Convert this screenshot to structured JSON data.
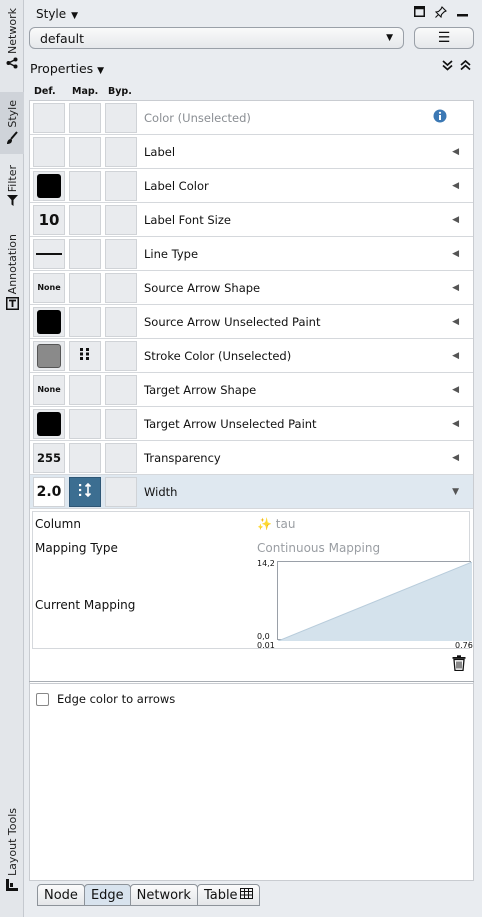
{
  "sidebar": {
    "tabs": [
      {
        "label": "Network",
        "icon": "share-icon"
      },
      {
        "label": "Style",
        "icon": "brush-icon",
        "active": true
      },
      {
        "label": "Filter",
        "icon": "funnel-icon"
      },
      {
        "label": "Annotation",
        "icon": "annotation-icon"
      },
      {
        "label": "Layout Tools",
        "icon": "layout-icon"
      }
    ]
  },
  "header": {
    "title": "Style",
    "style_select": "default",
    "properties_label": "Properties"
  },
  "columns": {
    "def": "Def.",
    "map": "Map.",
    "byp": "Byp."
  },
  "properties": [
    {
      "label": "Color (Unselected)",
      "def": "",
      "def_kind": "empty",
      "map_kind": "empty",
      "dim": true,
      "trailing": "info-icon"
    },
    {
      "label": "Label",
      "def": "",
      "def_kind": "empty",
      "map_kind": "empty"
    },
    {
      "label": "Label Color",
      "def": "",
      "def_kind": "black",
      "map_kind": "empty"
    },
    {
      "label": "Label Font Size",
      "def": "10",
      "def_kind": "big",
      "map_kind": "empty"
    },
    {
      "label": "Line Type",
      "def": "",
      "def_kind": "line",
      "map_kind": "empty"
    },
    {
      "label": "Source Arrow Shape",
      "def": "None",
      "def_kind": "small",
      "map_kind": "empty"
    },
    {
      "label": "Source Arrow Unselected Paint",
      "def": "",
      "def_kind": "black",
      "map_kind": "empty"
    },
    {
      "label": "Stroke Color (Unselected)",
      "def": "",
      "def_kind": "gray",
      "map_kind": "dots"
    },
    {
      "label": "Target Arrow Shape",
      "def": "None",
      "def_kind": "small",
      "map_kind": "empty"
    },
    {
      "label": "Target Arrow Unselected Paint",
      "def": "",
      "def_kind": "black",
      "map_kind": "empty"
    },
    {
      "label": "Transparency",
      "def": "255",
      "def_kind": "num",
      "map_kind": "empty"
    },
    {
      "label": "Width",
      "def": "2.0",
      "def_kind": "big",
      "map_kind": "active",
      "selected": true,
      "expanded": true
    }
  ],
  "mapping": {
    "column_label": "Column",
    "column_value": "tau",
    "type_label": "Mapping Type",
    "type_value": "Continuous Mapping",
    "current_label": "Current Mapping",
    "y_max": "14,2",
    "y_min": "0,0",
    "x_min": "0.01",
    "x_max": "0.76"
  },
  "options": {
    "edge_color_to_arrows": "Edge color to arrows"
  },
  "bottom_tabs": [
    "Node",
    "Edge",
    "Network",
    "Table"
  ],
  "active_bottom_tab": "Edge",
  "colors": {
    "accent": "#3c6e91",
    "selected_row": "#dfe8f0",
    "chart_fill": "#d4e2ec"
  }
}
